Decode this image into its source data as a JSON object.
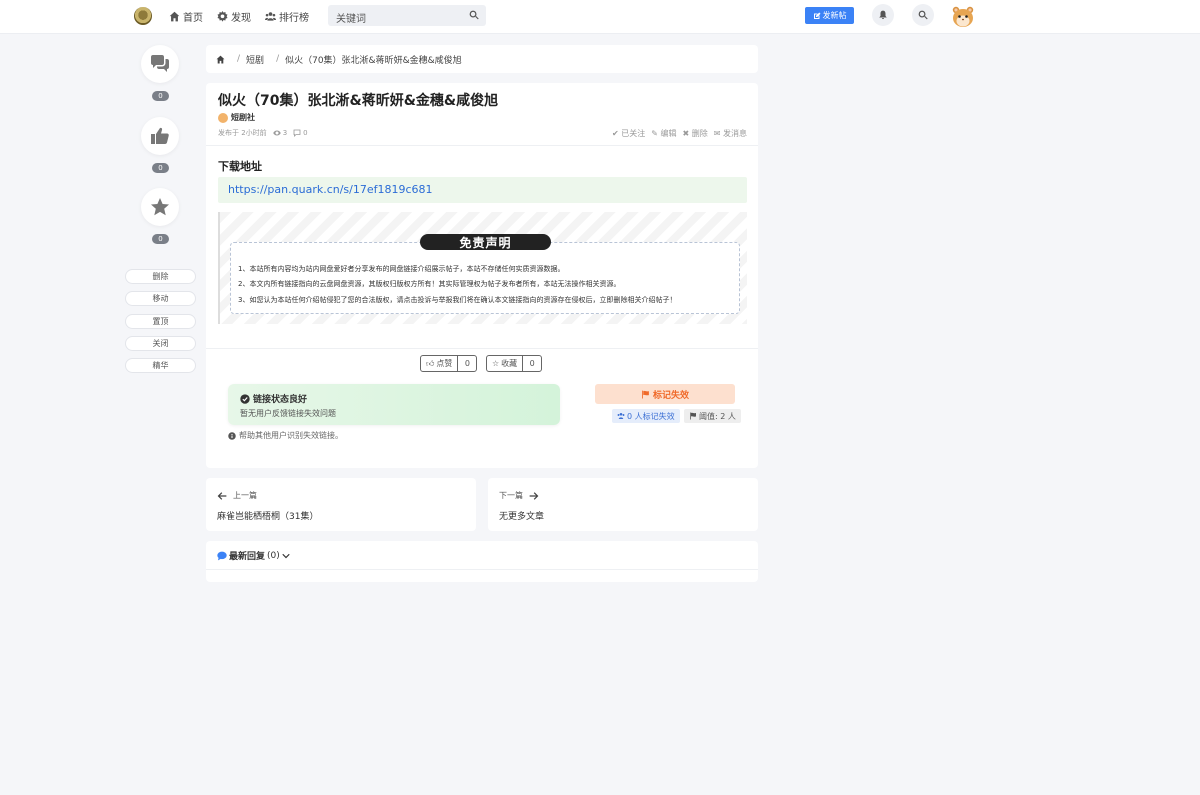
{
  "nav": {
    "home": "首页",
    "discover": "发现",
    "ranking": "排行榜",
    "search_placeholder": "关键词",
    "post_button": "发新帖"
  },
  "sidebar": {
    "comment_count": "0",
    "like_count": "0",
    "favorite_count": "0",
    "buttons": [
      "删除",
      "移动",
      "置顶",
      "关闭",
      "精华"
    ]
  },
  "breadcrumb": {
    "sep": "/",
    "category": "短剧",
    "current": "似火（70集）张北淅&蒋昕妍&金穗&咸俊旭"
  },
  "post": {
    "title": "似火（70集）张北淅&蒋昕妍&金穗&咸俊旭",
    "author": "短剧社",
    "published": "发布于 2小时前",
    "views": "3",
    "comments": "0",
    "actions": {
      "followed": "已关注",
      "edit": "编辑",
      "delete": "删除",
      "message": "发消息"
    },
    "download_title": "下载地址",
    "download_link": "https://pan.quark.cn/s/17ef1819c681"
  },
  "disclaimer": {
    "title": "免责声明",
    "lines": [
      "1、本站所有内容均为站内网盘爱好者分享发布的网盘链接介绍展示帖子，本站不存储任何实质资源数据。",
      "2、本文内所有链接指向的云盘网盘资源，其版权归版权方所有！其实际管理权为帖子发布者所有，本站无法操作相关资源。",
      "3、如您认为本站任何介绍帖侵犯了您的合法版权，请点击投诉与举报我们将在确认本文链接指向的资源存在侵权后，立即删除相关介绍帖子！"
    ]
  },
  "engage": {
    "like_label": "点赞",
    "like_count": "0",
    "fav_label": "收藏",
    "fav_count": "0"
  },
  "link_status": {
    "title": "链接状态良好",
    "sub": "暂无用户反馈链接失效问题",
    "help": "帮助其他用户识别失效链接。",
    "mark_button": "标记失效",
    "marked": "0 人标记失效",
    "threshold": "阈值: 2 人"
  },
  "pager": {
    "prev_label": "上一篇",
    "prev_title": "麻雀岂能栖梧桐（31集）",
    "next_label": "下一篇",
    "next_title": "无更多文章"
  },
  "replies": {
    "label": "最新回复",
    "count": "(0)"
  }
}
